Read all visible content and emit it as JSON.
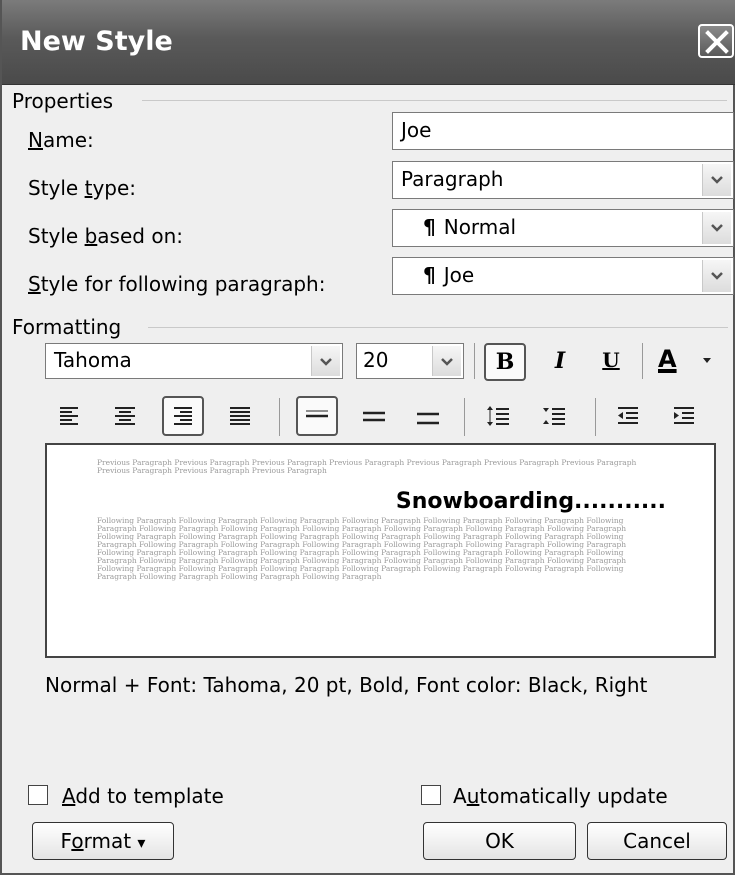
{
  "dialog": {
    "title": "New Style"
  },
  "properties": {
    "group_label": "Properties",
    "name_label_pre": "",
    "name_label_key": "N",
    "name_label_post": "ame:",
    "name_value": "Joe",
    "style_type_pre": "Style ",
    "style_type_key": "t",
    "style_type_post": "ype:",
    "style_type_value": "Paragraph",
    "based_on_pre": "Style ",
    "based_on_key": "b",
    "based_on_post": "ased on:",
    "based_on_mark": "¶",
    "based_on_value": "Normal",
    "following_pre": "",
    "following_key": "S",
    "following_post": "tyle for following paragraph:",
    "following_mark": "¶",
    "following_value": "Joe"
  },
  "formatting": {
    "group_label": "Formatting",
    "font": "Tahoma",
    "size": "20",
    "bold": "B",
    "italic": "I",
    "underline": "U",
    "font_color": "A",
    "font_color_swatch": "#000000"
  },
  "preview": {
    "previous": "Previous Paragraph Previous Paragraph Previous Paragraph Previous Paragraph Previous Paragraph Previous Paragraph Previous Paragraph Previous Paragraph Previous Paragraph Previous Paragraph",
    "sample": "Snowboarding...........",
    "following": "Following Paragraph Following Paragraph Following Paragraph Following Paragraph Following Paragraph Following Paragraph Following Paragraph Following Paragraph Following Paragraph Following Paragraph Following Paragraph Following Paragraph Following Paragraph Following Paragraph Following Paragraph Following Paragraph Following Paragraph Following Paragraph Following Paragraph Following Paragraph Following Paragraph Following Paragraph Following Paragraph Following Paragraph Following Paragraph Following Paragraph Following Paragraph Following Paragraph Following Paragraph Following Paragraph Following Paragraph Following Paragraph Following Paragraph Following Paragraph Following Paragraph Following Paragraph Following Paragraph Following Paragraph Following Paragraph Following Paragraph Following Paragraph Following Paragraph Following Paragraph Following Paragraph Following Paragraph Following Paragraph Following Paragraph Following Paragraph Following Paragraph"
  },
  "description": "Normal + Font: Tahoma, 20 pt, Bold, Font color: Black, Right",
  "options": {
    "add_template_pre": "",
    "add_template_key": "A",
    "add_template_post": "dd to template",
    "auto_update_pre": "A",
    "auto_update_key": "u",
    "auto_update_post": "tomatically update"
  },
  "buttons": {
    "format_pre": "F",
    "format_key": "o",
    "format_post": "rmat",
    "format_arrow": "▾",
    "ok": "OK",
    "cancel": "Cancel"
  }
}
